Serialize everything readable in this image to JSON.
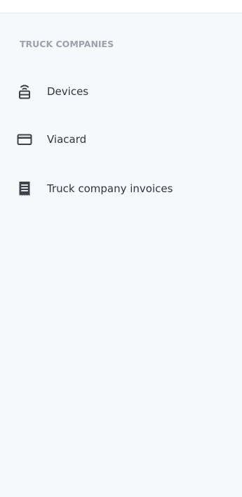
{
  "sidebar": {
    "section_title": "TRUCK COMPANIES",
    "items": [
      {
        "label": "Devices",
        "icon": "device-signal-icon"
      },
      {
        "label": "Viacard",
        "icon": "card-icon"
      },
      {
        "label": "Truck company invoices",
        "icon": "invoice-icon"
      }
    ]
  },
  "colors": {
    "background": "#f7f8fa",
    "text": "#2f3541",
    "section_title": "#9ba2ad",
    "icon": "#3d414a"
  }
}
